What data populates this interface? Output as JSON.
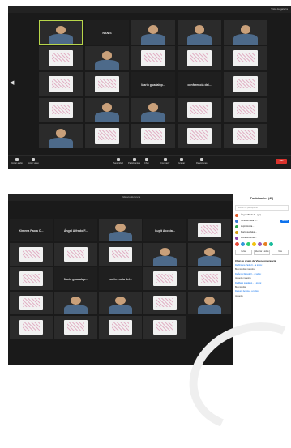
{
  "screenshot1": {
    "topbar_text": "Vista de galería",
    "tiles": [
      {
        "kind": "person",
        "tag": ""
      },
      {
        "kind": "name",
        "name": "NANIS"
      },
      {
        "kind": "person",
        "tag": ""
      },
      {
        "kind": "person",
        "tag": ""
      },
      {
        "kind": "person",
        "tag": ""
      },
      {
        "kind": "paper",
        "tag": ""
      },
      {
        "kind": "person",
        "tag": ""
      },
      {
        "kind": "paper",
        "tag": ""
      },
      {
        "kind": "paper",
        "tag": ""
      },
      {
        "kind": "paper",
        "tag": ""
      },
      {
        "kind": "paper",
        "tag": ""
      },
      {
        "kind": "paper",
        "tag": ""
      },
      {
        "kind": "name",
        "name": "Mario guadalup..."
      },
      {
        "kind": "name",
        "name": "conferencia del..."
      },
      {
        "kind": "paper",
        "tag": ""
      },
      {
        "kind": "paper",
        "tag": ""
      },
      {
        "kind": "person",
        "tag": ""
      },
      {
        "kind": "person",
        "tag": ""
      },
      {
        "kind": "paper",
        "tag": ""
      },
      {
        "kind": "paper",
        "tag": ""
      },
      {
        "kind": "person",
        "tag": ""
      },
      {
        "kind": "paper",
        "tag": ""
      },
      {
        "kind": "paper",
        "tag": ""
      },
      {
        "kind": "paper",
        "tag": ""
      },
      {
        "kind": "paper",
        "tag": ""
      }
    ],
    "toolbar": [
      {
        "label": "Iniciar audio",
        "icon": "microphone-icon"
      },
      {
        "label": "Iniciar video",
        "icon": "camera-icon"
      },
      {
        "label": "Seguridad",
        "icon": "shield-icon"
      },
      {
        "label": "Participantes",
        "icon": "people-icon"
      },
      {
        "label": "Chat",
        "icon": "chat-icon"
      },
      {
        "label": "Compartir",
        "icon": "share-icon"
      },
      {
        "label": "Grabar",
        "icon": "record-icon"
      },
      {
        "label": "Reacciones",
        "icon": "smile-icon"
      }
    ],
    "end_label": "Salir"
  },
  "screenshot2": {
    "titlebar": "Videoconferencia",
    "name_tiles": [
      "Ximena Paola C...",
      "Ángel Alfredo F...",
      "Lupit Acosta...",
      "Mario guadalup...",
      "conferencia del..."
    ],
    "tiles": [
      {
        "kind": "name",
        "name": "Ximena Paola C..."
      },
      {
        "kind": "name",
        "name": "Ángel Alfredo F..."
      },
      {
        "kind": "person",
        "tag": ""
      },
      {
        "kind": "name",
        "name": "Lupit Acosta..."
      },
      {
        "kind": "paper",
        "tag": ""
      },
      {
        "kind": "paper",
        "tag": ""
      },
      {
        "kind": "paper",
        "tag": ""
      },
      {
        "kind": "paper",
        "tag": ""
      },
      {
        "kind": "person",
        "tag": ""
      },
      {
        "kind": "person",
        "tag": ""
      },
      {
        "kind": "paper",
        "tag": ""
      },
      {
        "kind": "name",
        "name": "Mario guadalup..."
      },
      {
        "kind": "name",
        "name": "conferencia del..."
      },
      {
        "kind": "paper",
        "tag": ""
      },
      {
        "kind": "paper",
        "tag": ""
      },
      {
        "kind": "paper",
        "tag": ""
      },
      {
        "kind": "person",
        "tag": ""
      },
      {
        "kind": "person",
        "tag": ""
      },
      {
        "kind": "paper",
        "tag": ""
      },
      {
        "kind": "person",
        "tag": ""
      },
      {
        "kind": "paper",
        "tag": ""
      },
      {
        "kind": "paper",
        "tag": ""
      },
      {
        "kind": "paper",
        "tag": ""
      },
      {
        "kind": "paper",
        "tag": ""
      }
    ],
    "panel": {
      "title": "Participantes (45)",
      "search_placeholder": "Buscar un participante",
      "participants": [
        {
          "name": "Ángel Alfredo F... (yo)",
          "color": "#e05a2b",
          "button": ""
        },
        {
          "name": "Ximena Paola C...",
          "color": "#3a7bd5",
          "button": "Admitir"
        },
        {
          "name": "Lupit Acosta...",
          "color": "#2fa84f",
          "button": ""
        },
        {
          "name": "Mario guadalup...",
          "color": "#d4a017",
          "button": ""
        },
        {
          "name": "conferencia del...",
          "color": "#8e44ad",
          "button": ""
        }
      ],
      "emoji_colors": [
        "#e74c3c",
        "#3498db",
        "#2ecc71",
        "#f1c40f",
        "#9b59b6",
        "#e67e22",
        "#1abc9c"
      ],
      "buttons": [
        "Invitar",
        "Silenciar a todos",
        "Más"
      ],
      "chat_title": "Chat de grupo de Videoconferencia",
      "chat_messages": [
        {
          "text": "De Ximena Paola C... a todos:",
          "dark": false
        },
        {
          "text": "Buenos días maestra",
          "dark": true
        },
        {
          "text": "De Ángel Alfredo F... a todos:",
          "dark": false
        },
        {
          "text": "presente maestra",
          "dark": true
        },
        {
          "text": "De Mario guadalup... a todos:",
          "dark": false
        },
        {
          "text": "Buenos días",
          "dark": true
        },
        {
          "text": "De Lupit Acosta... a todos:",
          "dark": false
        },
        {
          "text": "presente",
          "dark": true
        }
      ]
    }
  }
}
